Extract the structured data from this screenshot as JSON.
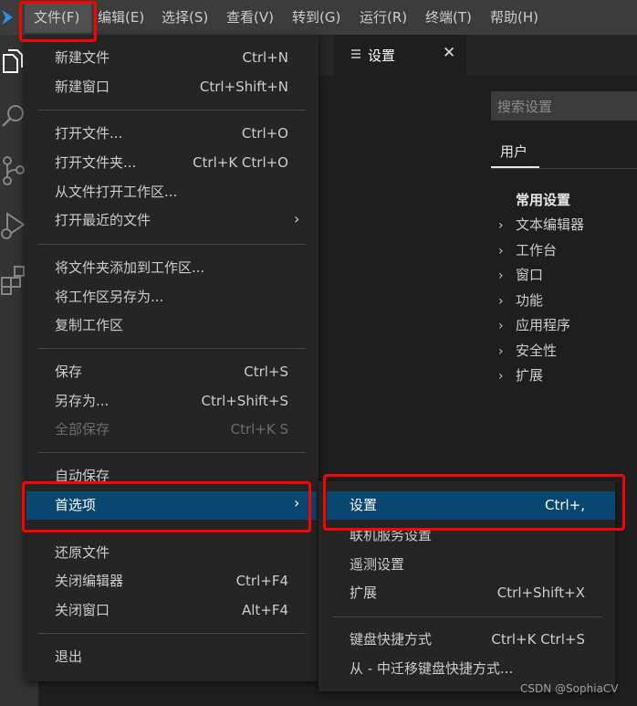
{
  "menubar": {
    "items": [
      "文件(F)",
      "编辑(E)",
      "选择(S)",
      "查看(V)",
      "转到(G)",
      "运行(R)",
      "终端(T)",
      "帮助(H)"
    ]
  },
  "activity_icons": [
    "explorer-icon",
    "search-icon",
    "source-control-icon",
    "run-debug-icon",
    "extensions-icon"
  ],
  "tab": {
    "label": "设置",
    "close": "✕",
    "icon": "settings-file-icon"
  },
  "settings": {
    "search_placeholder": "搜索设置",
    "scope_user": "用户",
    "common_title": "常用设置",
    "tree": [
      "文本编辑器",
      "工作台",
      "窗口",
      "功能",
      "应用程序",
      "安全性",
      "扩展"
    ]
  },
  "file_menu": {
    "items": [
      {
        "label": "新建文件",
        "shortcut": "Ctrl+N"
      },
      {
        "label": "新建窗口",
        "shortcut": "Ctrl+Shift+N"
      },
      {
        "label": "打开文件...",
        "shortcut": "Ctrl+O"
      },
      {
        "label": "打开文件夹...",
        "shortcut": "Ctrl+K Ctrl+O"
      },
      {
        "label": "从文件打开工作区...",
        "shortcut": ""
      },
      {
        "label": "打开最近的文件",
        "shortcut": ""
      },
      {
        "label": "将文件夹添加到工作区...",
        "shortcut": ""
      },
      {
        "label": "将工作区另存为...",
        "shortcut": ""
      },
      {
        "label": "复制工作区",
        "shortcut": ""
      },
      {
        "label": "保存",
        "shortcut": "Ctrl+S"
      },
      {
        "label": "另存为...",
        "shortcut": "Ctrl+Shift+S"
      },
      {
        "label": "全部保存",
        "shortcut": "Ctrl+K S"
      },
      {
        "label": "自动保存",
        "shortcut": ""
      },
      {
        "label": "首选项",
        "shortcut": ""
      },
      {
        "label": "还原文件",
        "shortcut": ""
      },
      {
        "label": "关闭编辑器",
        "shortcut": "Ctrl+F4"
      },
      {
        "label": "关闭窗口",
        "shortcut": "Alt+F4"
      },
      {
        "label": "退出",
        "shortcut": ""
      }
    ]
  },
  "preferences_menu": {
    "items": [
      {
        "label": "设置",
        "shortcut": "Ctrl+,"
      },
      {
        "label": "联机服务设置",
        "shortcut": ""
      },
      {
        "label": "遥测设置",
        "shortcut": ""
      },
      {
        "label": "扩展",
        "shortcut": "Ctrl+Shift+X"
      },
      {
        "label": "键盘快捷方式",
        "shortcut": "Ctrl+K Ctrl+S"
      },
      {
        "label": "从 - 中迁移键盘快捷方式...",
        "shortcut": ""
      }
    ]
  },
  "watermark": "CSDN @SophiaCV",
  "colors": {
    "menubar": "#3c3c3c",
    "menu_bg": "#252526",
    "highlight": "#094771",
    "annotation": "#ff0000",
    "accent": "#007acc"
  }
}
